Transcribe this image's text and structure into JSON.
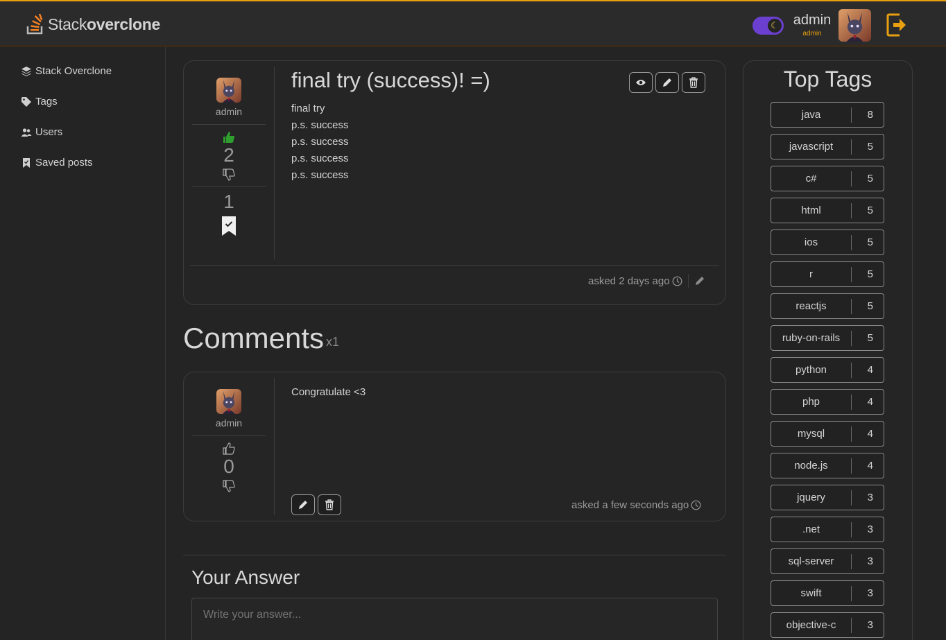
{
  "header": {
    "logo_word1": "Stack",
    "logo_word2": "overclone",
    "user_name": "admin",
    "user_role": "admin"
  },
  "sidebar": {
    "items": [
      {
        "label": "Stack Overclone",
        "icon": "layers-icon"
      },
      {
        "label": "Tags",
        "icon": "tag-icon"
      },
      {
        "label": "Users",
        "icon": "users-icon"
      },
      {
        "label": "Saved posts",
        "icon": "bookmark-icon"
      }
    ]
  },
  "post": {
    "title": "final try (success)! =)",
    "body_lines": [
      "final try",
      "p.s. success",
      "p.s. success",
      "p.s. success",
      "p.s. success"
    ],
    "author": "admin",
    "votes": "2",
    "saves": "1",
    "meta": "asked 2 days ago"
  },
  "comments": {
    "heading": "Comments",
    "count": "x1",
    "items": [
      {
        "author": "admin",
        "votes": "0",
        "text": "Congratulate <3",
        "meta": "asked a few seconds ago"
      }
    ]
  },
  "answer": {
    "heading": "Your Answer",
    "placeholder": "Write your answer..."
  },
  "tags": {
    "title": "Top Tags",
    "items": [
      {
        "name": "java",
        "count": "8"
      },
      {
        "name": "javascript",
        "count": "5"
      },
      {
        "name": "c#",
        "count": "5"
      },
      {
        "name": "html",
        "count": "5"
      },
      {
        "name": "ios",
        "count": "5"
      },
      {
        "name": "r",
        "count": "5"
      },
      {
        "name": "reactjs",
        "count": "5"
      },
      {
        "name": "ruby-on-rails",
        "count": "5"
      },
      {
        "name": "python",
        "count": "4"
      },
      {
        "name": "php",
        "count": "4"
      },
      {
        "name": "mysql",
        "count": "4"
      },
      {
        "name": "node.js",
        "count": "4"
      },
      {
        "name": "jquery",
        "count": "3"
      },
      {
        "name": ".net",
        "count": "3"
      },
      {
        "name": "sql-server",
        "count": "3"
      },
      {
        "name": "swift",
        "count": "3"
      },
      {
        "name": "objective-c",
        "count": "3"
      }
    ]
  },
  "colors": {
    "accent": "#e8a010",
    "upvote_active": "#2e9e2e",
    "toggle": "#6b3fd0"
  }
}
